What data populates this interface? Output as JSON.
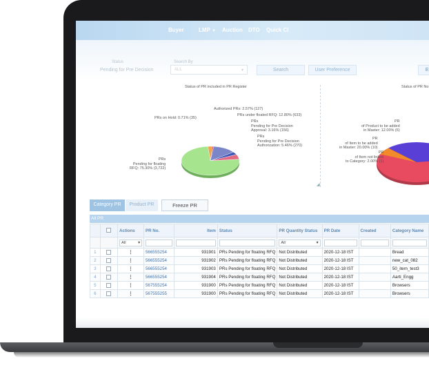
{
  "nav": {
    "items": [
      "Buyer",
      "LMP",
      "Auction",
      "DTO",
      "Quick CI"
    ]
  },
  "filters": {
    "label_a": "Status",
    "label_b": "Search By",
    "value_a": "Pending for Pre Decision",
    "select_value": "ALL",
    "search_btn": "Search",
    "user_pref_btn": "User Preference",
    "export_btn": "Ex"
  },
  "chart_left": {
    "title": "Status of PR included in PR Register",
    "labels": {
      "authorized": "Authorized PRs: 2.57% (127)",
      "hold": "PRs on Hold: 0.71% (35)",
      "floated_rfq": "PRs under floated RFQ: 12.80% (633)",
      "pre_approval": "PRs\nPending for Pre Decision\nApproval: 3.16% (156)",
      "pre_auth": "PRs\nPending for Pre Decision\nAuthorization: 5.46% (270)",
      "floating": "PRs\nPending for floating\nRFQ: 75.30% (3,722)"
    }
  },
  "chart_right": {
    "title": "Status of PR No",
    "labels": {
      "product_master": "PR\nof Product to be added\nin Master: 12.00% (6)",
      "item_master": "PR\nof Item to be added\nin Master: 20.00% (10)",
      "not_linked": "PR\nof Item not linked\nto Category: 2.00% (1)"
    }
  },
  "chart_data": [
    {
      "type": "pie",
      "title": "Status of PR included in PR Register",
      "categories": [
        "Authorized PRs",
        "PRs on Hold",
        "PRs under floated RFQ",
        "PRs Pending for Pre Decision Approval",
        "PRs Pending for Pre Decision Authorization",
        "PRs Pending for floating RFQ"
      ],
      "values": [
        2.57,
        0.71,
        12.8,
        3.16,
        5.46,
        75.3
      ],
      "counts": [
        127,
        35,
        633,
        156,
        270,
        3722
      ],
      "colors": [
        "#f2a24a",
        "#c44c6a",
        "#7b86c9",
        "#3c57b5",
        "#e46a83",
        "#a6e58e"
      ]
    },
    {
      "type": "pie",
      "title": "Status of PR No",
      "categories": [
        "PR of Product to be added in Master",
        "PR of Item to be added in Master",
        "PR of Item not linked to Category"
      ],
      "values": [
        12.0,
        20.0,
        2.0
      ],
      "counts": [
        6,
        10,
        1
      ],
      "colors": [
        "#5a3fd6",
        "#e84a5f",
        "#f28a2c"
      ]
    }
  ],
  "tabs": {
    "category": "Category PR",
    "product": "Product PR",
    "freeze": "Freeze PR"
  },
  "grid": {
    "title": "All PR",
    "columns": {
      "actions": "Actions",
      "pr_no": "PR No.",
      "item": "Item",
      "status": "Status",
      "qty_status": "PR Quantity Status",
      "pr_date": "PR Date",
      "created": "Created",
      "category": "Category Name"
    },
    "filter_all": "All",
    "rows": [
      {
        "n": "1",
        "pr": "566555254",
        "item": "931901",
        "status": "PRs Pending for floating RFQ",
        "qty": "Not Distributed",
        "date": "2020-12-18 IST",
        "created": "",
        "category": "Bread"
      },
      {
        "n": "2",
        "pr": "566555254",
        "item": "931902",
        "status": "PRs Pending for floating RFQ",
        "qty": "Not Distributed",
        "date": "2020-12-18 IST",
        "created": "",
        "category": "new_cat_082"
      },
      {
        "n": "3",
        "pr": "566555254",
        "item": "931903",
        "status": "PRs Pending for floating RFQ",
        "qty": "Not Distributed",
        "date": "2020-12-18 IST",
        "created": "",
        "category": "50_item_test3"
      },
      {
        "n": "4",
        "pr": "566555254",
        "item": "931904",
        "status": "PRs Pending for floating RFQ",
        "qty": "Not Distributed",
        "date": "2020-12-18 IST",
        "created": "",
        "category": "Aarti_Engg"
      },
      {
        "n": "5",
        "pr": "567555254",
        "item": "931900",
        "status": "PRs Pending for floating RFQ",
        "qty": "Not Distributed",
        "date": "2020-12-18 IST",
        "created": "",
        "category": "Browsers"
      },
      {
        "n": "6",
        "pr": "567555255",
        "item": "931900",
        "status": "PRs Pending for floating RFQ",
        "qty": "Not Distributed",
        "date": "2020-12-18 IST",
        "created": "",
        "category": "Browsers"
      }
    ]
  }
}
